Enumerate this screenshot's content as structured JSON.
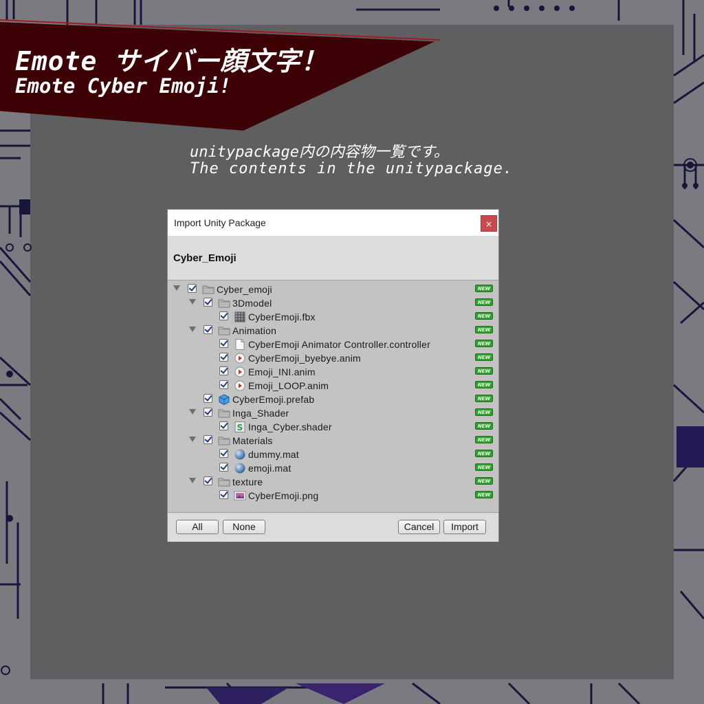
{
  "banner": {
    "title_jp": "Emote サイバー顔文字！",
    "title_en": "Emote Cyber Emoji!"
  },
  "subtitle": {
    "jp": "unitypackage内の内容物一覧です。",
    "en": "The contents in the unitypackage."
  },
  "dialog": {
    "window_title": "Import Unity Package",
    "close_label": "×",
    "package_name": "Cyber_Emoji",
    "new_badge": "NEW",
    "tree": [
      {
        "label": "Cyber_emoji",
        "depth": 0,
        "icon": "folder",
        "expandable": true,
        "checked": true
      },
      {
        "label": "3Dmodel",
        "depth": 1,
        "icon": "folder",
        "expandable": true,
        "checked": true
      },
      {
        "label": "CyberEmoji.fbx",
        "depth": 2,
        "icon": "model",
        "expandable": false,
        "checked": true
      },
      {
        "label": "Animation",
        "depth": 1,
        "icon": "folder",
        "expandable": true,
        "checked": true
      },
      {
        "label": "CyberEmoji Animator Controller.controller",
        "depth": 2,
        "icon": "document",
        "expandable": false,
        "checked": true
      },
      {
        "label": "CyberEmoji_byebye.anim",
        "depth": 2,
        "icon": "anim",
        "expandable": false,
        "checked": true
      },
      {
        "label": "Emoji_INI.anim",
        "depth": 2,
        "icon": "anim",
        "expandable": false,
        "checked": true
      },
      {
        "label": "Emoji_LOOP.anim",
        "depth": 2,
        "icon": "anim",
        "expandable": false,
        "checked": true
      },
      {
        "label": "CyberEmoji.prefab",
        "depth": 1,
        "icon": "prefab",
        "expandable": false,
        "checked": true
      },
      {
        "label": "Inga_Shader",
        "depth": 1,
        "icon": "folder",
        "expandable": true,
        "checked": true
      },
      {
        "label": "Inga_Cyber.shader",
        "depth": 2,
        "icon": "shader",
        "expandable": false,
        "checked": true
      },
      {
        "label": "Materials",
        "depth": 1,
        "icon": "folder",
        "expandable": true,
        "checked": true
      },
      {
        "label": "dummy.mat",
        "depth": 2,
        "icon": "material",
        "expandable": false,
        "checked": true
      },
      {
        "label": "emoji.mat",
        "depth": 2,
        "icon": "material",
        "expandable": false,
        "checked": true
      },
      {
        "label": "texture",
        "depth": 1,
        "icon": "folder",
        "expandable": true,
        "checked": true
      },
      {
        "label": "CyberEmoji.png",
        "depth": 2,
        "icon": "image",
        "expandable": false,
        "checked": true
      }
    ],
    "buttons": {
      "all": "All",
      "none": "None",
      "cancel": "Cancel",
      "import": "Import"
    }
  },
  "colors": {
    "background": "#5f5f62",
    "banner": "#3d0206",
    "circuit_accent": "#2a1a5a",
    "new_badge": "#2f9f2f"
  }
}
